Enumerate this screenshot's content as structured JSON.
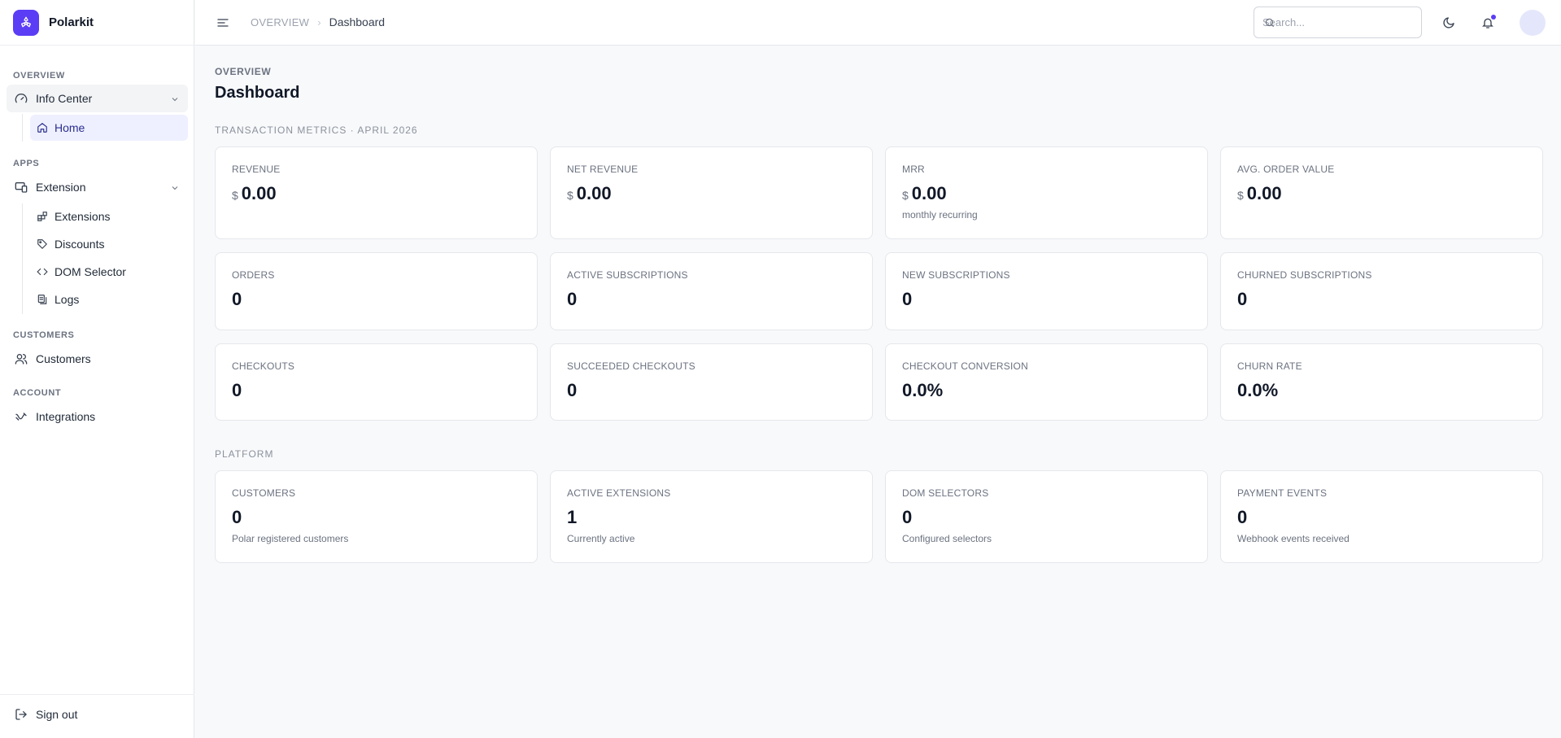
{
  "brand": {
    "name": "Polarkit",
    "accent": "#5b3df5"
  },
  "sidebar": {
    "sections": {
      "overview": "OVERVIEW",
      "apps": "APPS",
      "customers": "CUSTOMERS",
      "account": "ACCOUNT"
    },
    "info_center": {
      "label": "Info Center",
      "icon": "gauge-icon"
    },
    "home": {
      "label": "Home",
      "icon": "home-icon"
    },
    "extension": {
      "label": "Extension",
      "icon": "monitor-phone-icon"
    },
    "extension_items": [
      {
        "label": "Extensions",
        "icon": "blocks-icon"
      },
      {
        "label": "Discounts",
        "icon": "tag-icon"
      },
      {
        "label": "DOM Selector",
        "icon": "code-icon"
      },
      {
        "label": "Logs",
        "icon": "logs-icon"
      }
    ],
    "customers": {
      "label": "Customers",
      "icon": "users-icon"
    },
    "integrations": {
      "label": "Integrations",
      "icon": "cable-icon"
    },
    "sign_out": {
      "label": "Sign out",
      "icon": "log-out-icon"
    }
  },
  "header": {
    "breadcrumb_parent": "OVERVIEW",
    "breadcrumb_current": "Dashboard",
    "search_placeholder": "Search..."
  },
  "main": {
    "eyebrow": "OVERVIEW",
    "title": "Dashboard",
    "transaction_section": "TRANSACTION METRICS · APRIL 2026",
    "platform_section": "PLATFORM",
    "transaction_cards": [
      {
        "label": "REVENUE",
        "currency": "$",
        "value": "0.00",
        "sub": ""
      },
      {
        "label": "NET REVENUE",
        "currency": "$",
        "value": "0.00",
        "sub": ""
      },
      {
        "label": "MRR",
        "currency": "$",
        "value": "0.00",
        "sub": "monthly recurring"
      },
      {
        "label": "AVG. ORDER VALUE",
        "currency": "$",
        "value": "0.00",
        "sub": ""
      },
      {
        "label": "ORDERS",
        "currency": "",
        "value": "0",
        "sub": ""
      },
      {
        "label": "ACTIVE SUBSCRIPTIONS",
        "currency": "",
        "value": "0",
        "sub": ""
      },
      {
        "label": "NEW SUBSCRIPTIONS",
        "currency": "",
        "value": "0",
        "sub": ""
      },
      {
        "label": "CHURNED SUBSCRIPTIONS",
        "currency": "",
        "value": "0",
        "sub": ""
      },
      {
        "label": "CHECKOUTS",
        "currency": "",
        "value": "0",
        "sub": ""
      },
      {
        "label": "SUCCEEDED CHECKOUTS",
        "currency": "",
        "value": "0",
        "sub": ""
      },
      {
        "label": "CHECKOUT CONVERSION",
        "currency": "",
        "value": "0.0%",
        "sub": ""
      },
      {
        "label": "CHURN RATE",
        "currency": "",
        "value": "0.0%",
        "sub": ""
      }
    ],
    "platform_cards": [
      {
        "label": "CUSTOMERS",
        "value": "0",
        "sub": "Polar registered customers"
      },
      {
        "label": "ACTIVE EXTENSIONS",
        "value": "1",
        "sub": "Currently active"
      },
      {
        "label": "DOM SELECTORS",
        "value": "0",
        "sub": "Configured selectors"
      },
      {
        "label": "PAYMENT EVENTS",
        "value": "0",
        "sub": "Webhook events received"
      }
    ]
  }
}
